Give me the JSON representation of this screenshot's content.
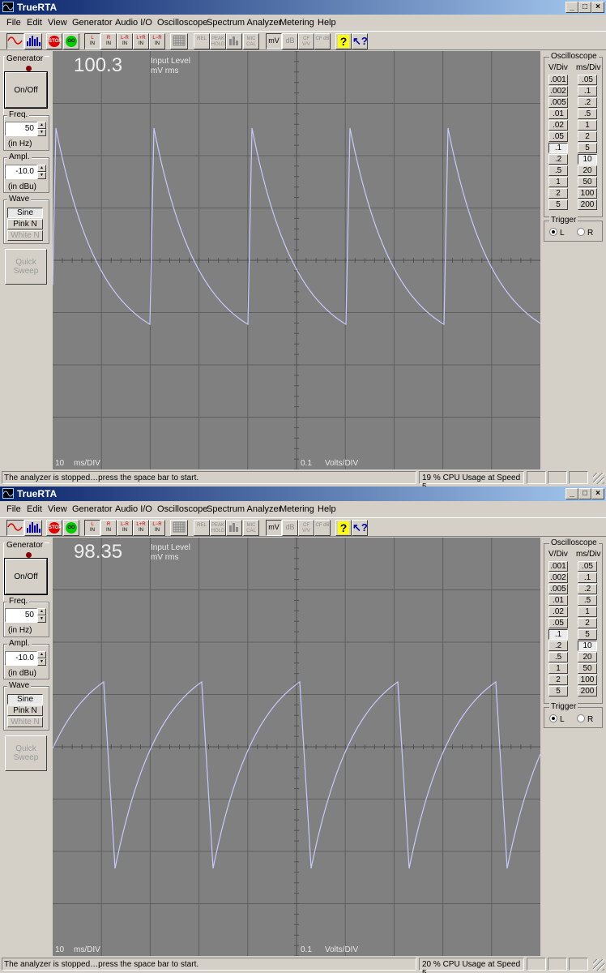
{
  "windows": [
    {
      "title": "TrueRTA",
      "title_buttons": [
        "_",
        "□",
        "×"
      ],
      "menu": [
        "File",
        "Edit",
        "View",
        "Generator",
        "Audio I/O",
        "Oscilloscope",
        "Spectrum Analyzer",
        "Metering",
        "Help"
      ],
      "toolbar": {
        "stop": "STOP",
        "go": "GO",
        "inputs": [
          "L",
          "R",
          "L-R",
          "L+R",
          "L−R"
        ],
        "in_label": "IN",
        "rel": "REL",
        "peak_hold": "PEAK HOLD",
        "mic_cal": "MIC CAL",
        "mv": "mV",
        "db": "dB",
        "cf_vv": "CF V/V",
        "cf_db": "CF dB",
        "help_icon": "help-icon",
        "context_help_icon": "context-help-icon"
      },
      "generator": {
        "title": "Generator",
        "on_off": "On/Off",
        "freq_label": "Freq.",
        "freq_value": "50",
        "freq_unit": "(in Hz)",
        "ampl_label": "Ampl.",
        "ampl_value": "-10.0",
        "ampl_unit": "(in dBu)",
        "wave_label": "Wave",
        "waves": [
          "Sine",
          "Pink N",
          "White N"
        ],
        "quick_sweep": "Quick Sweep"
      },
      "scope": {
        "reading": "100.3",
        "level_label": "Input Level",
        "level_unit": "mV rms",
        "time_scale": "10",
        "time_unit": "ms/DIV",
        "volt_scale": "0.1",
        "volt_unit": "Volts/DIV",
        "trace_shape": "decay",
        "trace_color": "#c8c8ff"
      },
      "oscilloscope": {
        "title": "Oscilloscope",
        "vdiv_label": "V/Div",
        "msdiv_label": "ms/Div",
        "vdiv": [
          ".001",
          ".002",
          ".005",
          ".01",
          ".02",
          ".05",
          ".1",
          ".2",
          ".5",
          "1",
          "2",
          "5"
        ],
        "msdiv": [
          ".05",
          ".1",
          ".2",
          ".5",
          "1",
          "2",
          "5",
          "10",
          "20",
          "50",
          "100",
          "200"
        ],
        "vdiv_selected": 6,
        "msdiv_selected": 7,
        "trigger_label": "Trigger",
        "trigger_left": "L",
        "trigger_right": "R",
        "trigger_selected": "L"
      },
      "status": {
        "message": "The analyzer is stopped…press the space bar to start.",
        "cpu": "19 % CPU Usage at Speed 5"
      }
    },
    {
      "title": "TrueRTA",
      "title_buttons": [
        "_",
        "□",
        "×"
      ],
      "menu": [
        "File",
        "Edit",
        "View",
        "Generator",
        "Audio I/O",
        "Oscilloscope",
        "Spectrum Analyzer",
        "Metering",
        "Help"
      ],
      "toolbar": {
        "stop": "STOP",
        "go": "GO",
        "inputs": [
          "L",
          "R",
          "L-R",
          "L+R",
          "L−R"
        ],
        "in_label": "IN",
        "rel": "REL",
        "peak_hold": "PEAK HOLD",
        "mic_cal": "MIC CAL",
        "mv": "mV",
        "db": "dB",
        "cf_vv": "CF V/V",
        "cf_db": "CF dB",
        "help_icon": "help-icon",
        "context_help_icon": "context-help-icon"
      },
      "generator": {
        "title": "Generator",
        "on_off": "On/Off",
        "freq_label": "Freq.",
        "freq_value": "50",
        "freq_unit": "(in Hz)",
        "ampl_label": "Ampl.",
        "ampl_value": "-10.0",
        "ampl_unit": "(in dBu)",
        "wave_label": "Wave",
        "waves": [
          "Sine",
          "Pink N",
          "White N"
        ],
        "quick_sweep": "Quick Sweep"
      },
      "scope": {
        "reading": "98.35",
        "level_label": "Input Level",
        "level_unit": "mV rms",
        "time_scale": "10",
        "time_unit": "ms/DIV",
        "volt_scale": "0.1",
        "volt_unit": "Volts/DIV",
        "trace_shape": "charge",
        "trace_color": "#c8c8ff"
      },
      "oscilloscope": {
        "title": "Oscilloscope",
        "vdiv_label": "V/Div",
        "msdiv_label": "ms/Div",
        "vdiv": [
          ".001",
          ".002",
          ".005",
          ".01",
          ".02",
          ".05",
          ".1",
          ".2",
          ".5",
          "1",
          "2",
          "5"
        ],
        "msdiv": [
          ".05",
          ".1",
          ".2",
          ".5",
          "1",
          "2",
          "5",
          "10",
          "20",
          "50",
          "100",
          "200"
        ],
        "vdiv_selected": 6,
        "msdiv_selected": 7,
        "trigger_label": "Trigger",
        "trigger_left": "L",
        "trigger_right": "R",
        "trigger_selected": "L"
      },
      "status": {
        "message": "The analyzer is stopped…press the space bar to start.",
        "cpu": "20 % CPU Usage at Speed 5"
      }
    }
  ]
}
